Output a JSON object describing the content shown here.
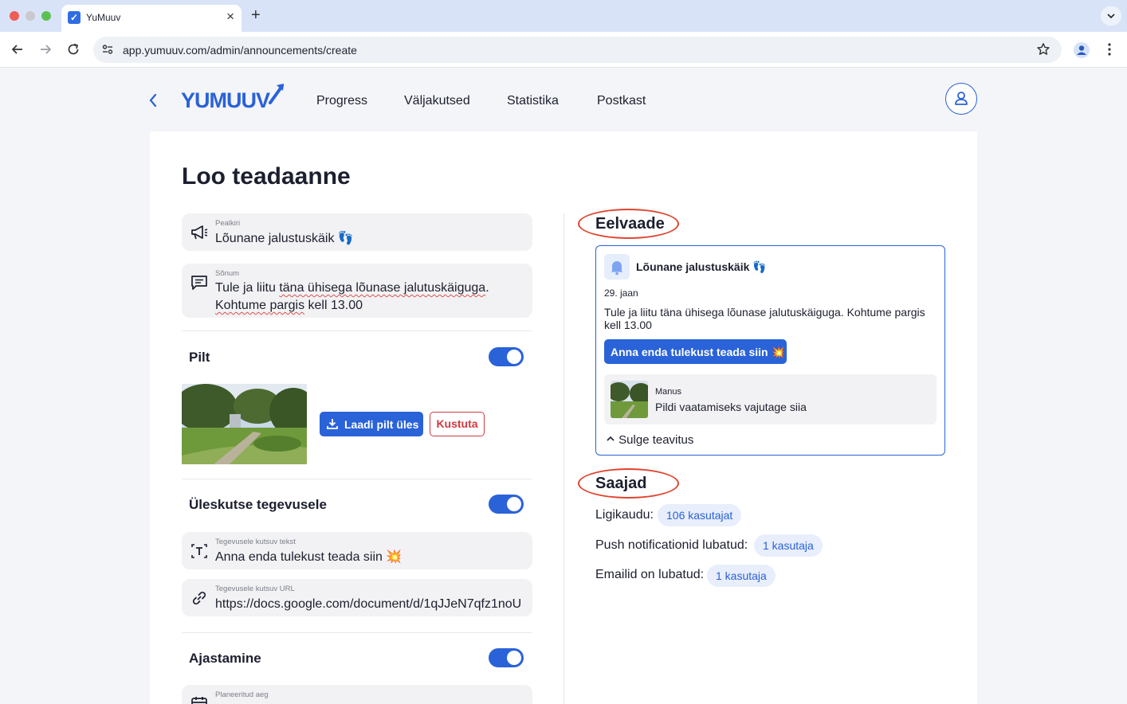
{
  "browser": {
    "tab_title": "YuMuuv",
    "url": "app.yumuuv.com/admin/announcements/create"
  },
  "header": {
    "logo_text": "YUMUUV",
    "nav": [
      "Progress",
      "Väljakutsed",
      "Statistika",
      "Postkast"
    ]
  },
  "page": {
    "title": "Loo teadaanne"
  },
  "form": {
    "title_field": {
      "label": "Pealkiri",
      "value": "Lõunane jalustuskäik 👣"
    },
    "message_field": {
      "label": "Sõnum",
      "value_line1_a": "Tule ja liitu ",
      "value_line1_b": "täna ühisega lõunase jalutuskäiguga",
      "value_line1_c": ".",
      "value_line2_a": "Kohtume ",
      "value_line2_b": "pargis",
      "value_line2_c": " kell 13.00"
    },
    "image_section": {
      "title": "Pilt",
      "upload_label": "Laadi pilt üles",
      "delete_label": "Kustuta"
    },
    "cta_section": {
      "title": "Üleskutse tegevusele",
      "text_field": {
        "label": "Tegevusele kutsuv tekst",
        "value": "Anna enda tulekust teada siin 💥"
      },
      "url_field": {
        "label": "Tegevusele kutsuv URL",
        "value": "https://docs.google.com/document/d/1qJJeN7qfz1noU"
      }
    },
    "schedule_section": {
      "title": "Ajastamine",
      "time_field": {
        "label": "Planeeritud aeg"
      }
    }
  },
  "preview": {
    "heading": "Eelvaade",
    "title": "Lõunane jalustuskäik 👣",
    "date": "29. jaan",
    "message": "Tule ja liitu täna ühisega lõunase jalutuskäiguga. Kohtume pargis kell 13.00",
    "cta": "Anna enda tulekust teada siin 💥",
    "attachment_label": "Manus",
    "attachment_text": "Pildi vaatamiseks vajutage siia",
    "close_label": "Sulge teavitus"
  },
  "recipients": {
    "heading": "Saajad",
    "rows": [
      {
        "label": "Ligikaudu:",
        "value": "106 kasutajat"
      },
      {
        "label": "Push notificationid lubatud:",
        "value": "1 kasutaja"
      },
      {
        "label": "Emailid on lubatud:",
        "value": "1 kasutaja"
      }
    ]
  },
  "colors": {
    "accent": "#2a62d8",
    "danger": "#d0393f",
    "annotation": "#e0452f"
  },
  "icons": [
    "back-icon",
    "forward-icon",
    "reload-icon",
    "site-settings-icon",
    "bookmark-star-icon",
    "profile-icon",
    "menu-icon",
    "megaphone-icon",
    "message-icon",
    "upload-icon",
    "text-icon",
    "link-icon",
    "calendar-icon",
    "bell-icon",
    "chevron-up-icon",
    "user-icon"
  ]
}
